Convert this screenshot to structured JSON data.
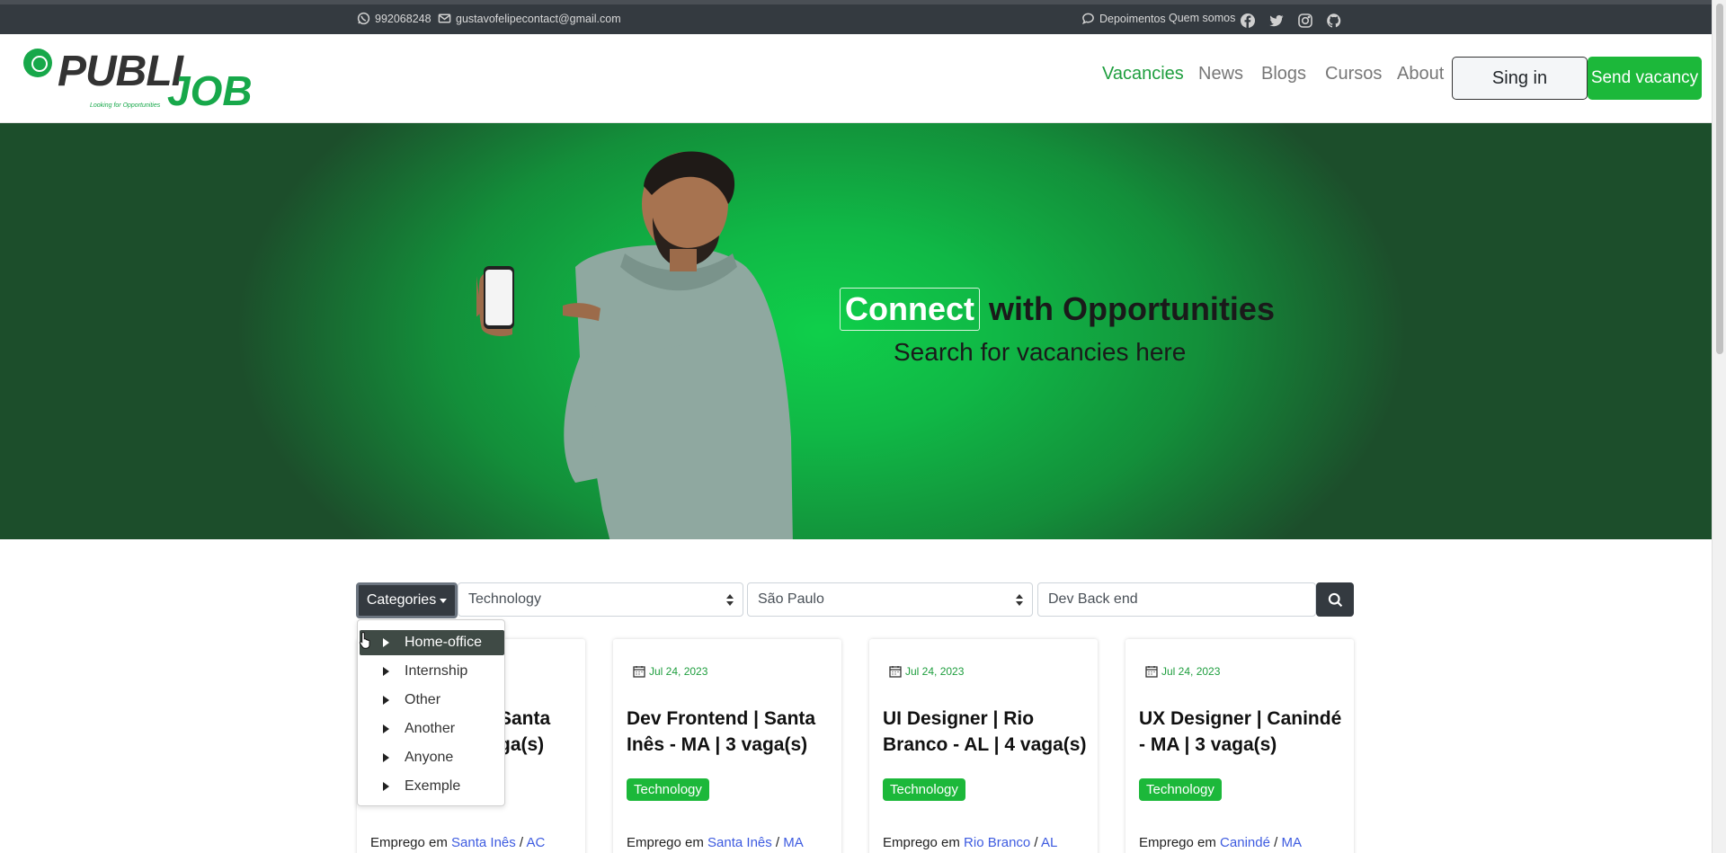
{
  "topbar": {
    "phone": "992068248",
    "email": "gustavofelipecontact@gmail.com",
    "testimonials": "Depoimentos",
    "about_us": "Quem somos",
    "social_icons": [
      "facebook-icon",
      "twitter-icon",
      "instagram-icon",
      "github-icon"
    ]
  },
  "brand": {
    "name_part1": "PUBLI",
    "name_part2": "JOB",
    "tagline": "Looking for Opportunities",
    "accent_color": "#1cb83a"
  },
  "nav": {
    "links": [
      {
        "label": "Vacancies",
        "active": true
      },
      {
        "label": "News",
        "active": false
      },
      {
        "label": "Blogs",
        "active": false
      },
      {
        "label": "Cursos",
        "active": false
      },
      {
        "label": "About",
        "active": false
      }
    ],
    "signin_label": "Sing in",
    "send_vacancy_label": "Send vacancy"
  },
  "hero": {
    "highlight": "Connect",
    "title_rest": "with Opportunities",
    "subtitle": "Search for vacancies here"
  },
  "search": {
    "categories_label": "Categories",
    "category_value": "Technology",
    "location_value": "São Paulo",
    "query_value": "Dev Back end"
  },
  "dropdown": {
    "items": [
      "Home-office",
      "Internship",
      "Other",
      "Another",
      "Anyone",
      "Exemple"
    ],
    "active_index": 0
  },
  "cards": [
    {
      "date": "",
      "title": "Dev Backend | Santa Inês - AC | 2 vaga(s)",
      "title_line1": "Santa",
      "title_line2": "ga(s)",
      "tag": "",
      "loc_prefix": "Emprego em",
      "city": "Santa Inês",
      "state": "AC"
    },
    {
      "date": "Jul 24, 2023",
      "title_line1": "Dev Frontend | Santa",
      "title_line2": "Inês - MA | 3 vaga(s)",
      "tag": "Technology",
      "loc_prefix": "Emprego em",
      "city": "Santa Inês",
      "state": "MA"
    },
    {
      "date": "Jul 24, 2023",
      "title_line1": "UI Designer | Rio",
      "title_line2": "Branco - AL | 4 vaga(s)",
      "tag": "Technology",
      "loc_prefix": "Emprego em",
      "city": "Rio Branco",
      "state": "AL"
    },
    {
      "date": "Jul 24, 2023",
      "title_line1": "UX Designer | Canindé",
      "title_line2": "- MA | 3 vaga(s)",
      "tag": "Technology",
      "loc_prefix": "Emprego em",
      "city": "Canindé",
      "state": "MA"
    }
  ]
}
